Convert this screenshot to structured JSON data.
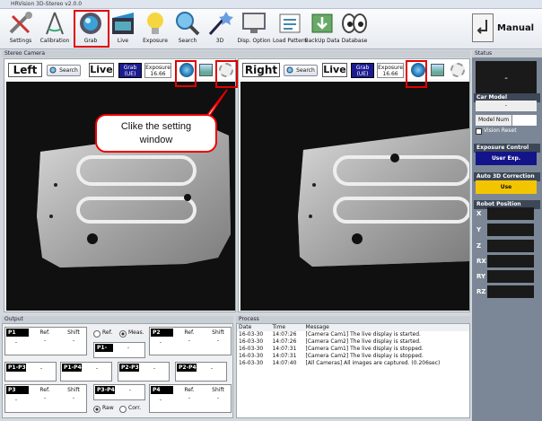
{
  "window": {
    "title": "HRVision 3D-Stereo v2.0.0"
  },
  "toolbar": {
    "items": [
      {
        "label": "Settings",
        "icon": "settings-icon"
      },
      {
        "label": "Calibration",
        "icon": "calibration-icon"
      },
      {
        "label": "Grab",
        "icon": "grab-icon"
      },
      {
        "label": "Live",
        "icon": "live-icon"
      },
      {
        "label": "Exposure",
        "icon": "exposure-icon"
      },
      {
        "label": "Search",
        "icon": "search-icon"
      },
      {
        "label": "3D",
        "icon": "3d-icon"
      },
      {
        "label": "Disp. Option",
        "icon": "display-option-icon"
      },
      {
        "label": "Load Pattern",
        "icon": "load-pattern-icon"
      },
      {
        "label": "BackUp Data",
        "icon": "backup-icon"
      },
      {
        "label": "Database",
        "icon": "database-icon"
      }
    ],
    "mode_label": "Manual"
  },
  "stereo": {
    "section_title": "Stereo Camera",
    "left": {
      "title": "Left",
      "search": "Search",
      "live": "Live",
      "grab_line1": "Grab",
      "grab_line2": "(UE)",
      "exposure_label": "Exposure",
      "exposure_value": "16.66"
    },
    "right": {
      "title": "Right",
      "search": "Search",
      "live": "Live",
      "grab_line1": "Grab",
      "grab_line2": "(UE)",
      "exposure_label": "Exposure",
      "exposure_value": "16.66"
    },
    "callout": "Clike the setting window"
  },
  "status": {
    "title": "Status",
    "display_value": "-",
    "car_model_title": "Car Model",
    "car_model_value": "-",
    "model_num_label": "Model Num",
    "model_num_value": "",
    "vision_reset_label": "Vision Reset",
    "exposure_control_title": "Exposure Control",
    "exposure_control_value": "User Exp.",
    "auto3d_title": "Auto 3D Correction",
    "auto3d_value": "Use",
    "robot_title": "Robot Position",
    "robot_labels": [
      "X",
      "Y",
      "Z",
      "RX",
      "RY",
      "RZ"
    ]
  },
  "output": {
    "title": "Output",
    "ref": "Ref.",
    "shift": "Shift",
    "dash": "-",
    "boxes": [
      "P1",
      "P2",
      "P3",
      "P4",
      "P1-P2",
      "P1-P3",
      "P1-P4",
      "P2-P3",
      "P2-P4",
      "P3-P4"
    ],
    "radio_ref": "Ref.",
    "radio_meas": "Meas.",
    "radio_raw": "Raw",
    "radio_corr": "Corr."
  },
  "process": {
    "title": "Process",
    "columns": [
      "Date",
      "Time",
      "Message"
    ],
    "rows": [
      [
        "16-03-30",
        "14:07:26",
        "[Camera Cam1] The live display is started."
      ],
      [
        "16-03-30",
        "14:07:26",
        "[Camera Cam2] The live display is started."
      ],
      [
        "16-03-30",
        "14:07:31",
        "[Camera Cam1] The live display is stopped."
      ],
      [
        "16-03-30",
        "14:07:31",
        "[Camera Cam2] The live display is stopped."
      ],
      [
        "16-03-30",
        "14:07:40",
        "[All Cameras] All images are captured. (0.206sec)"
      ]
    ]
  }
}
